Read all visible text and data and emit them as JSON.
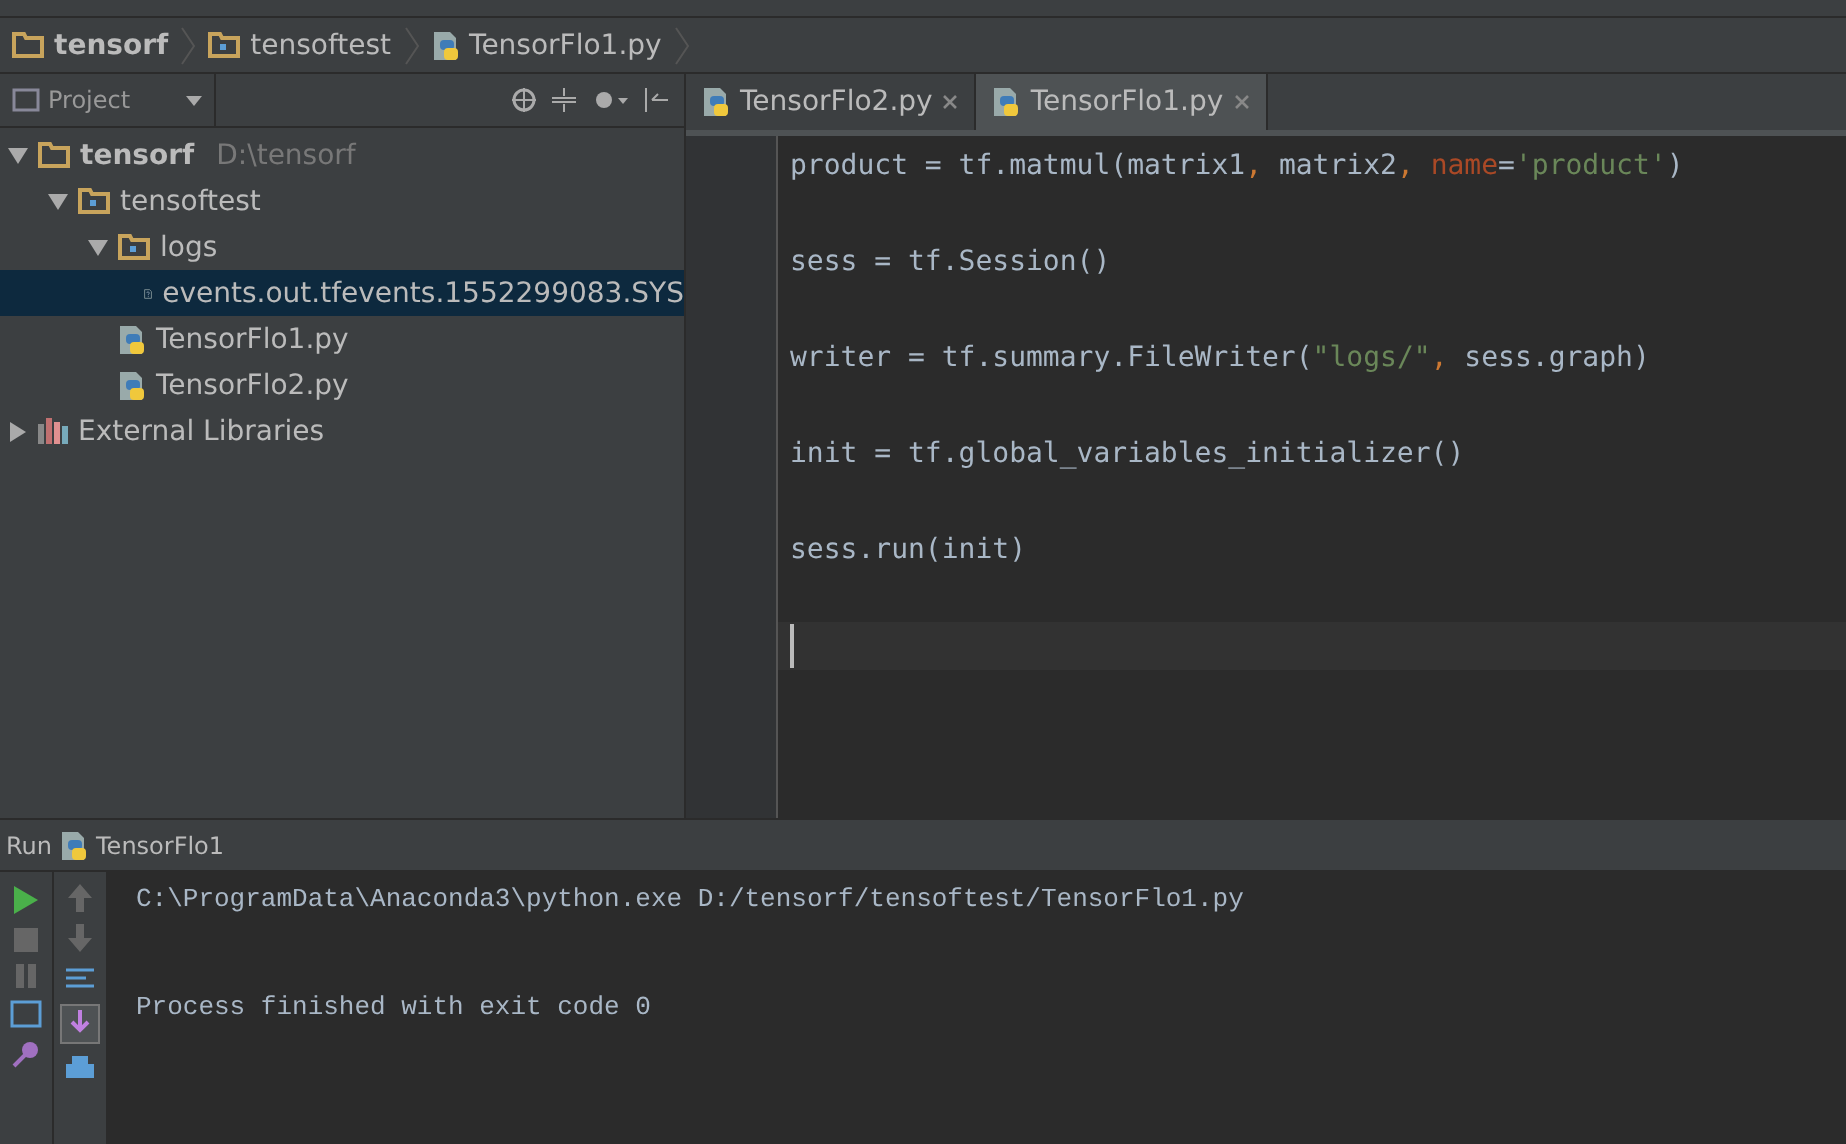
{
  "breadcrumb": [
    {
      "label": "tensorf",
      "kind": "folder",
      "bold": true
    },
    {
      "label": "tensoftest",
      "kind": "module",
      "bold": false
    },
    {
      "label": "TensorFlo1.py",
      "kind": "python",
      "bold": false
    }
  ],
  "project_panel": {
    "title": "Project",
    "tree": [
      {
        "label": "tensorf",
        "path": "D:\\tensorf",
        "kind": "folder",
        "expanded": true,
        "selected": false,
        "children": [
          {
            "label": "tensoftest",
            "kind": "module",
            "expanded": true,
            "selected": false,
            "children": [
              {
                "label": "logs",
                "kind": "module",
                "expanded": true,
                "selected": false,
                "children": [
                  {
                    "label": "events.out.tfevents.1552299083.SYS",
                    "kind": "unknown",
                    "selected": true
                  }
                ]
              },
              {
                "label": "TensorFlo1.py",
                "kind": "python",
                "selected": false
              },
              {
                "label": "TensorFlo2.py",
                "kind": "python",
                "selected": false
              }
            ]
          }
        ]
      },
      {
        "label": "External Libraries",
        "kind": "library",
        "expanded": false,
        "selected": false
      }
    ]
  },
  "editor_tabs": [
    {
      "label": "TensorFlo2.py",
      "selected": false
    },
    {
      "label": "TensorFlo1.py",
      "selected": true
    }
  ],
  "code_lines": [
    [
      {
        "kind": "plain",
        "text": "product = tf.matmul(matrix1"
      },
      {
        "kind": "comma",
        "text": ","
      },
      {
        "kind": "plain",
        "text": " matrix2"
      },
      {
        "kind": "comma",
        "text": ", "
      },
      {
        "kind": "named-arg",
        "text": "name"
      },
      {
        "kind": "plain",
        "text": "="
      },
      {
        "kind": "string",
        "text": "'product'"
      },
      {
        "kind": "plain",
        "text": ")"
      }
    ],
    [
      {
        "kind": "plain",
        "text": "sess = tf.Session()"
      }
    ],
    [
      {
        "kind": "plain",
        "text": "writer = tf.summary.FileWriter("
      },
      {
        "kind": "string",
        "text": "\"logs/\""
      },
      {
        "kind": "comma",
        "text": ","
      },
      {
        "kind": "plain",
        "text": " sess.graph)"
      }
    ],
    [
      {
        "kind": "plain",
        "text": "init = tf.global_variables_initializer()"
      }
    ],
    [
      {
        "kind": "plain",
        "text": "sess.run(init)"
      }
    ]
  ],
  "run_panel": {
    "title": "Run",
    "config": "TensorFlo1",
    "output": [
      "C:\\ProgramData\\Anaconda3\\python.exe D:/tensorf/tensoftest/TensorFlo1.py",
      "Process finished with exit code 0"
    ]
  }
}
